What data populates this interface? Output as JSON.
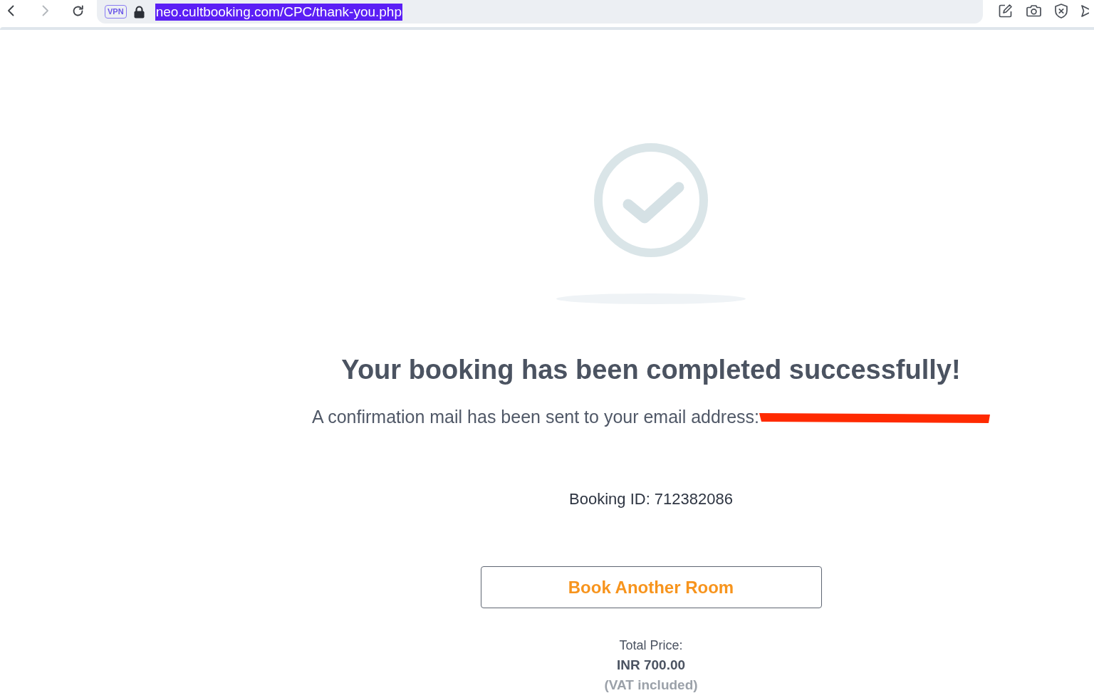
{
  "browser": {
    "nav_buttons": [
      {
        "kind": "back",
        "disabled": false
      },
      {
        "kind": "forward",
        "disabled": true
      },
      {
        "kind": "reload",
        "disabled": false
      }
    ],
    "vpn_badge": "VPN",
    "address": {
      "url": "neo.cultbooking.com/CPC/thank-you.php",
      "selected": true
    }
  },
  "confirmation": {
    "heading": "Your booking has been completed successfully!",
    "message": "A confirmation mail has been sent to your email address:",
    "email_redacted": true,
    "booking_id": "Booking ID: 712382086",
    "button": "Book Another Room",
    "total_label": "Total Price:",
    "total_amount": "INR 700.00",
    "tax_note": "(VAT included)"
  }
}
